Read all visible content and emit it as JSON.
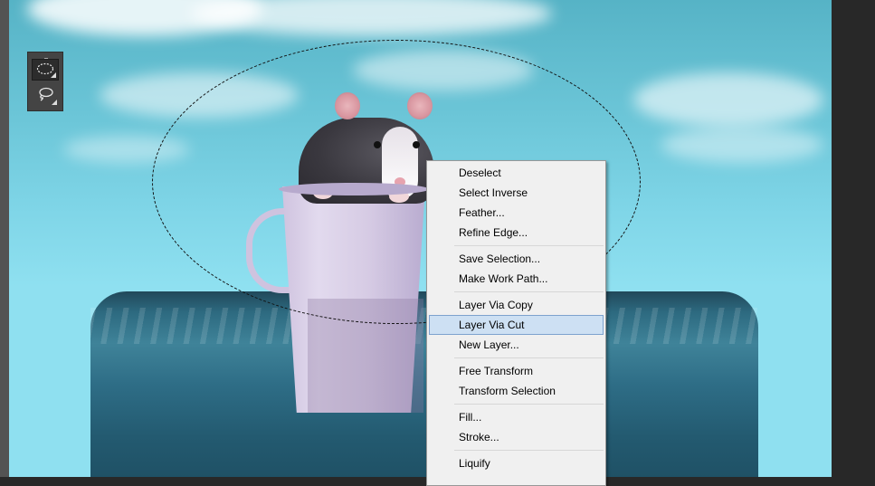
{
  "canvas": {
    "description_icons": [
      "rat-image",
      "cup-image",
      "water-image"
    ]
  },
  "tools": {
    "items": [
      {
        "name": "elliptical-marquee-tool",
        "active": true
      },
      {
        "name": "lasso-tool",
        "active": false
      }
    ]
  },
  "context_menu": {
    "items": [
      {
        "label": "Deselect"
      },
      {
        "label": "Select Inverse"
      },
      {
        "label": "Feather..."
      },
      {
        "label": "Refine Edge..."
      },
      {
        "label": "Save Selection..."
      },
      {
        "label": "Make Work Path..."
      },
      {
        "label": "Layer Via Copy"
      },
      {
        "label": "Layer Via Cut"
      },
      {
        "label": "New Layer..."
      },
      {
        "label": "Free Transform"
      },
      {
        "label": "Transform Selection"
      },
      {
        "label": "Fill..."
      },
      {
        "label": "Stroke..."
      },
      {
        "label": "Liquify"
      }
    ],
    "highlighted_index": 7
  },
  "colors": {
    "menu_highlight": "#cde0f3",
    "menu_highlight_border": "#7da2ce",
    "pasteboard": "#282828"
  }
}
